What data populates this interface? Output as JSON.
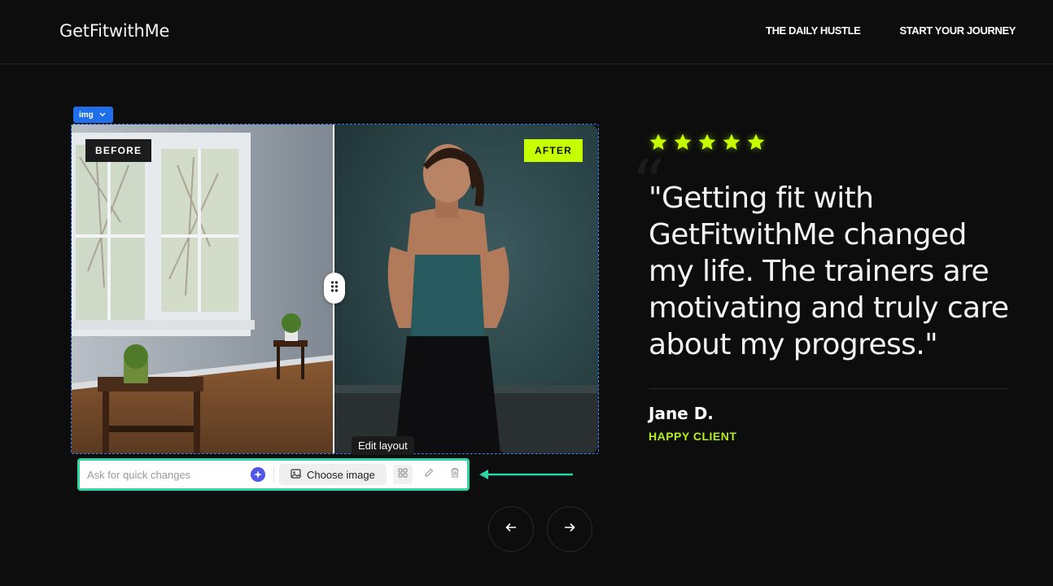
{
  "header": {
    "logo": "GetFitwithMe",
    "nav": [
      "THE DAILY HUSTLE",
      "START YOUR JOURNEY"
    ]
  },
  "editor": {
    "element_tag": "img",
    "tooltip": "Edit layout",
    "toolbar": {
      "input_placeholder": "Ask for quick changes",
      "choose_image_label": "Choose image"
    }
  },
  "comparison": {
    "before_label": "BEFORE",
    "after_label": "AFTER",
    "slider_position": 0.5
  },
  "testimonial": {
    "rating": 5,
    "quote": "\"Getting fit with GetFitwithMe changed my life. The trainers are motivating and truly care about my progress.\"",
    "author": "Jane D.",
    "role": "HAPPY CLIENT"
  },
  "colors": {
    "accent": "#c6ff00",
    "selection": "#3b82f6",
    "toolbar_highlight": "#2ed3a8",
    "background": "#0d0d0d"
  },
  "icons": {
    "prev": "arrow-left-icon",
    "next": "arrow-right-icon",
    "handle": "drag-handle-icon",
    "star": "star-icon",
    "ai": "sparkle-icon",
    "image": "image-icon",
    "layout": "grid-icon",
    "edit": "pencil-icon",
    "delete": "trash-icon"
  }
}
